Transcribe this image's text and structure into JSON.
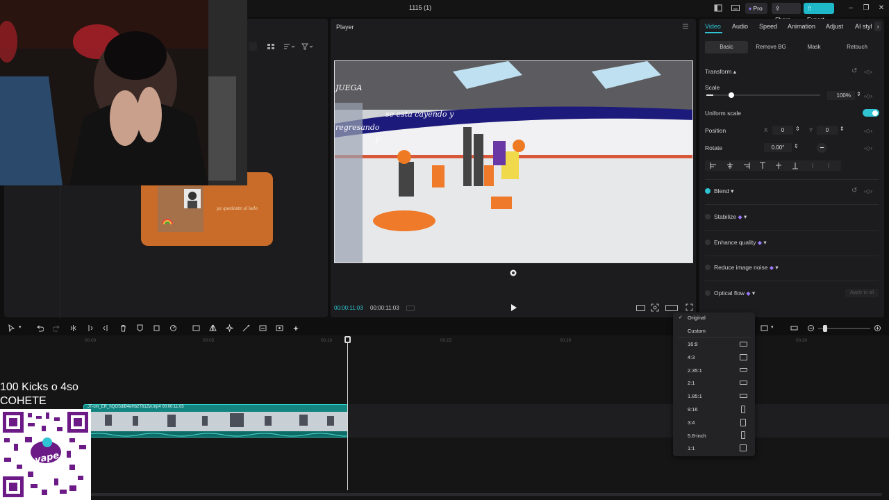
{
  "titlebar": {
    "title": "1115 (1)",
    "pro_label": "Pro",
    "share_label": "Share",
    "export_label": "Export"
  },
  "player": {
    "title": "Player",
    "time_current": "00:00:11:03",
    "time_total": "00:00:11:03",
    "overlay_comments": [
      "JUEGA",
      "se esta cayendo y",
      "regresando",
      "F"
    ]
  },
  "card": {
    "caption": "ya quedaste al lado"
  },
  "inspector": {
    "tabs": [
      "Video",
      "Audio",
      "Speed",
      "Animation",
      "Adjust",
      "AI styl"
    ],
    "subtabs": [
      "Basic",
      "Remove BG",
      "Mask",
      "Retouch"
    ],
    "transform_label": "Transform",
    "scale_label": "Scale",
    "scale_value": "100%",
    "scale_fraction": 0.06,
    "uniform_scale_label": "Uniform scale",
    "position_label": "Position",
    "pos_x_label": "X",
    "pos_x": "0",
    "pos_y_label": "Y",
    "pos_y": "0",
    "rotate_label": "Rotate",
    "rotate_value": "0.00°",
    "blend_label": "Blend",
    "stabilize_label": "Stabilize",
    "enhance_label": "Enhance quality",
    "reduce_noise_label": "Reduce image noise",
    "optical_flow_label": "Optical flow",
    "apply_all_label": "Apply to all"
  },
  "timeline": {
    "ticks": [
      "00:00",
      "00:05",
      "00:10",
      "00:15",
      "00:20",
      "00:30"
    ],
    "clip_name": "JT-cm_ER_hQGSdiB4eHb2T61Zw.mp4   00:00:11:03"
  },
  "overlay": {
    "kicks_line1": "100 Kicks o 4so",
    "kicks_line2": "COHETE"
  },
  "ratio_menu": {
    "items": [
      "Original",
      "Custom",
      "16:9",
      "4:3",
      "2.35:1",
      "2:1",
      "1.85:1",
      "9:16",
      "3:4",
      "5.8-inch",
      "1:1"
    ],
    "selected": "Original"
  },
  "colors": {
    "accent": "#2fc3d3",
    "clip": "#13847f",
    "pro": "#9a7bff"
  }
}
